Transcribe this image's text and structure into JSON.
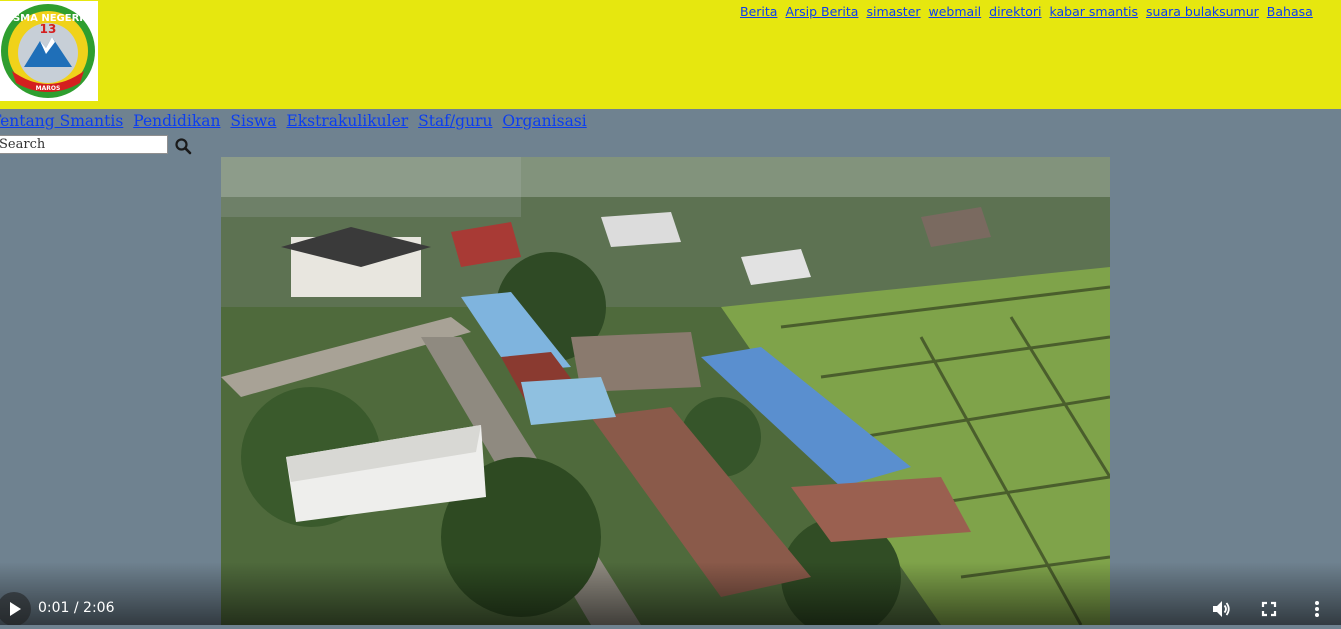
{
  "header": {
    "logo": {
      "alt_text": "SMA NEGERI 13 MAROS",
      "line1": "SMA NEGERI",
      "number": "13",
      "line2": "MAROS"
    },
    "top_links": [
      "Berita",
      "Arsip Berita",
      "simaster",
      "webmail",
      "direktori",
      "kabar smantis",
      "suara bulaksumur",
      "Bahasa"
    ]
  },
  "nav": {
    "items": [
      "Tentang Smantis",
      "Pendidikan",
      "Siswa",
      "Ekstrakulikuler",
      "Staf/guru",
      "Organisasi"
    ]
  },
  "search": {
    "placeholder": "Search",
    "value": "",
    "button_icon": "search-icon"
  },
  "video": {
    "time_display": "0:01 / 2:06",
    "progress_fraction": 0.008,
    "controls": [
      "play-icon",
      "volume-icon",
      "fullscreen-icon",
      "more-options-icon"
    ]
  },
  "colors": {
    "header_bg": "#e6e70f",
    "page_bg": "#6f8290",
    "link": "#0b3df0"
  }
}
